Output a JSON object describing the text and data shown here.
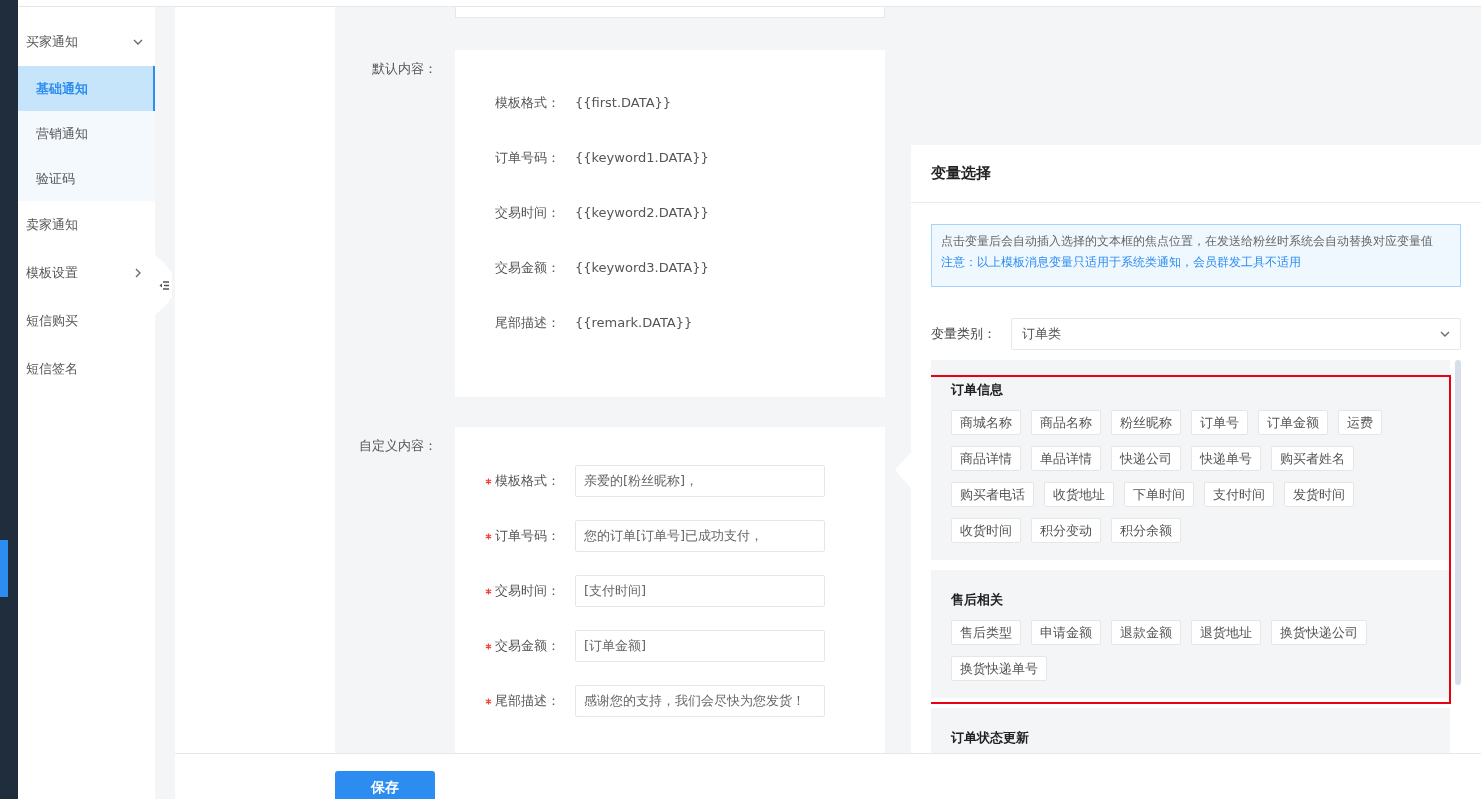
{
  "sidebar": {
    "items": [
      {
        "label": "买家通知",
        "expanded": true,
        "children": [
          {
            "label": "基础通知",
            "selected": true
          },
          {
            "label": "营销通知",
            "selected": false
          },
          {
            "label": "验证码",
            "selected": false
          }
        ]
      },
      {
        "label": "卖家通知",
        "selected": false
      },
      {
        "label": "模板设置",
        "expanded": false,
        "selected": false
      },
      {
        "label": "短信购买",
        "selected": false
      },
      {
        "label": "短信签名",
        "selected": false
      }
    ]
  },
  "default_content": {
    "label": "默认内容：",
    "rows": [
      {
        "label": "模板格式：",
        "value": "{{first.DATA}}"
      },
      {
        "label": "订单号码：",
        "value": "{{keyword1.DATA}}"
      },
      {
        "label": "交易时间：",
        "value": "{{keyword2.DATA}}"
      },
      {
        "label": "交易金额：",
        "value": "{{keyword3.DATA}}"
      },
      {
        "label": "尾部描述：",
        "value": "{{remark.DATA}}"
      }
    ]
  },
  "custom_content": {
    "label": "自定义内容：",
    "fields": [
      {
        "label": "模板格式：",
        "required": true,
        "value": "亲爱的[粉丝昵称]，"
      },
      {
        "label": "订单号码：",
        "required": true,
        "value": "您的订单[订单号]已成功支付，"
      },
      {
        "label": "交易时间：",
        "required": true,
        "value": "[支付时间]"
      },
      {
        "label": "交易金额：",
        "required": true,
        "value": "[订单金额]"
      },
      {
        "label": "尾部描述：",
        "required": true,
        "value": "感谢您的支持，我们会尽快为您发货！"
      }
    ]
  },
  "variable_panel": {
    "title": "变量选择",
    "notice": {
      "text": "点击变量后会自动插入选择的文本框的焦点位置，在发送给粉丝时系统会自动替换对应变量值",
      "note": "注意：以上模板消息变量只适用于系统类通知，会员群发工具不适用"
    },
    "category": {
      "label": "变量类别：",
      "value": "订单类"
    },
    "groups": [
      {
        "title": "订单信息",
        "tags": [
          "商城名称",
          "商品名称",
          "粉丝昵称",
          "订单号",
          "订单金额",
          "运费",
          "商品详情",
          "单品详情",
          "快递公司",
          "快递单号",
          "购买者姓名",
          "购买者电话",
          "收货地址",
          "下单时间",
          "支付时间",
          "发货时间",
          "收货时间",
          "积分变动",
          "积分余额"
        ]
      },
      {
        "title": "售后相关",
        "tags": [
          "售后类型",
          "申请金额",
          "退款金额",
          "退货地址",
          "换货快递公司",
          "换货快递单号"
        ]
      },
      {
        "title": "订单状态更新"
      }
    ]
  },
  "save_button": "保存"
}
